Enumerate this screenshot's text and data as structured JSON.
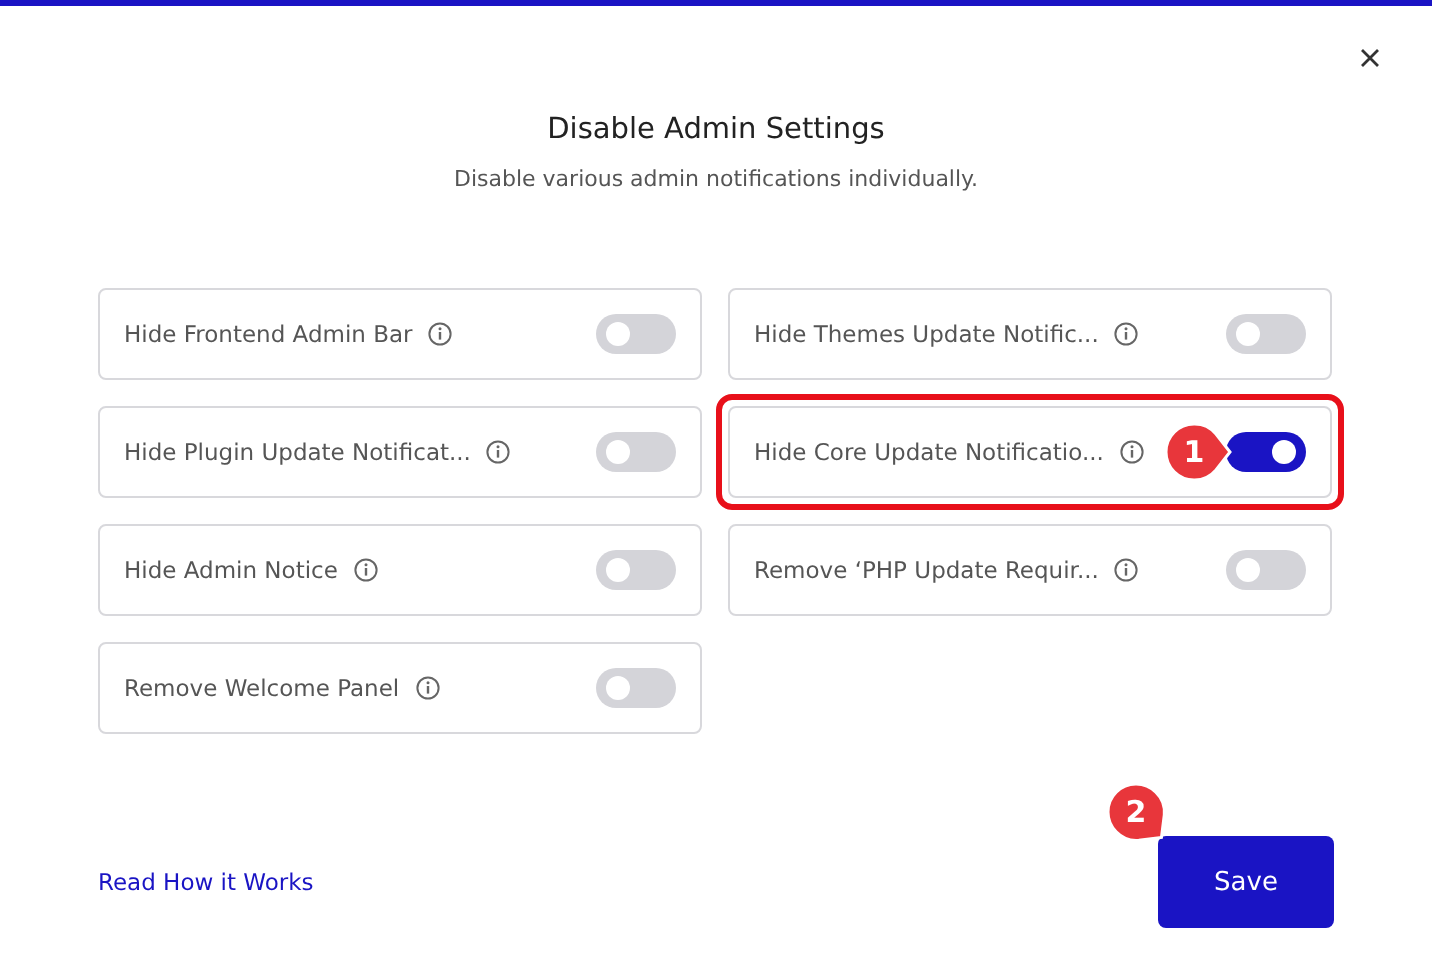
{
  "dialog": {
    "title": "Disable Admin Settings",
    "subtitle": "Disable various admin notifications individually."
  },
  "settings": [
    {
      "label": "Hide Frontend Admin Bar",
      "on": false,
      "highlighted": false
    },
    {
      "label": "Hide Themes Update Notific...",
      "on": false,
      "highlighted": false
    },
    {
      "label": "Hide Plugin Update Notificat...",
      "on": false,
      "highlighted": false
    },
    {
      "label": "Hide Core Update Notificatio...",
      "on": true,
      "highlighted": true,
      "callout": {
        "label": "1"
      }
    },
    {
      "label": "Hide Admin Notice",
      "on": false,
      "highlighted": false
    },
    {
      "label": "Remove ‘PHP Update Requir...",
      "on": false,
      "highlighted": false
    },
    {
      "label": "Remove Welcome Panel",
      "on": false,
      "highlighted": false
    }
  ],
  "footer": {
    "link": "Read How it Works",
    "save": {
      "label": "Save",
      "callout": {
        "label": "2"
      }
    }
  }
}
